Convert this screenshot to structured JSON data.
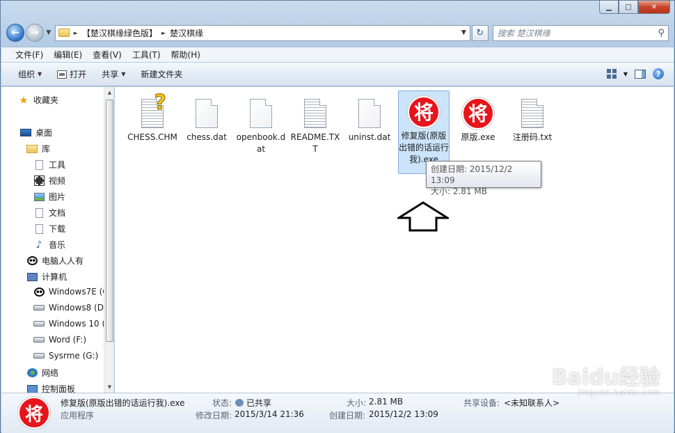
{
  "titlebar": {
    "minimize": "▁",
    "maximize": "□",
    "close": "✕"
  },
  "address": {
    "crumbs": [
      "【楚汉棋缘绿色版】",
      "楚汉棋缘"
    ],
    "search_placeholder": "搜索 楚汉棋缘"
  },
  "menu": [
    "文件(F)",
    "编辑(E)",
    "查看(V)",
    "工具(T)",
    "帮助(H)"
  ],
  "toolbar": {
    "organize": "组织",
    "print": "打开",
    "share": "共享",
    "new_folder": "新建文件夹"
  },
  "nav": {
    "favorites": "收藏夹",
    "desktop": "桌面",
    "library": "库",
    "tools": "工具",
    "video": "视频",
    "pictures": "图片",
    "docs": "文档",
    "downloads": "下载",
    "music": "音乐",
    "renren": "电脑人人有",
    "computer": "计算机",
    "drives": [
      "Windows7E (C",
      "Windows8 (D",
      "Windows 10 (",
      "Word (F:)",
      "Sysrme (G:)"
    ],
    "network": "网络",
    "control_panel": "控制面板"
  },
  "files": [
    {
      "name": "CHESS.CHM",
      "icon": "help-file-icon"
    },
    {
      "name": "chess.dat",
      "icon": "blank-file-icon"
    },
    {
      "name": "openbook.dat",
      "icon": "blank-file-icon"
    },
    {
      "name": "README.TXT",
      "icon": "text-file-icon"
    },
    {
      "name": "uninst.dat",
      "icon": "blank-file-icon"
    },
    {
      "name": "修复版(原版出错的话运行我).exe",
      "icon": "jiang-exe-icon",
      "selected": true
    },
    {
      "name": "原版.exe",
      "icon": "jiang-exe-icon"
    },
    {
      "name": "注册码.txt",
      "icon": "text-file-icon"
    }
  ],
  "jiang_char": "将",
  "tooltip": {
    "created": "创建日期: 2015/12/2 13:09",
    "size": "大小: 2.81 MB"
  },
  "details": {
    "filename": "修复版(原版出错的话运行我).exe",
    "type": "应用程序",
    "status_label": "状态:",
    "status_value": "已共享",
    "modified_label": "修改日期:",
    "modified_value": "2015/3/14 21:36",
    "size_label": "大小:",
    "size_value": "2.81 MB",
    "created_label": "创建日期:",
    "created_value": "2015/12/2 13:09",
    "share_label": "共享设备:",
    "share_value": "<未知联系人>"
  },
  "watermark": {
    "main": "Baidu经验",
    "sub": "jingyan.baidu.com"
  }
}
